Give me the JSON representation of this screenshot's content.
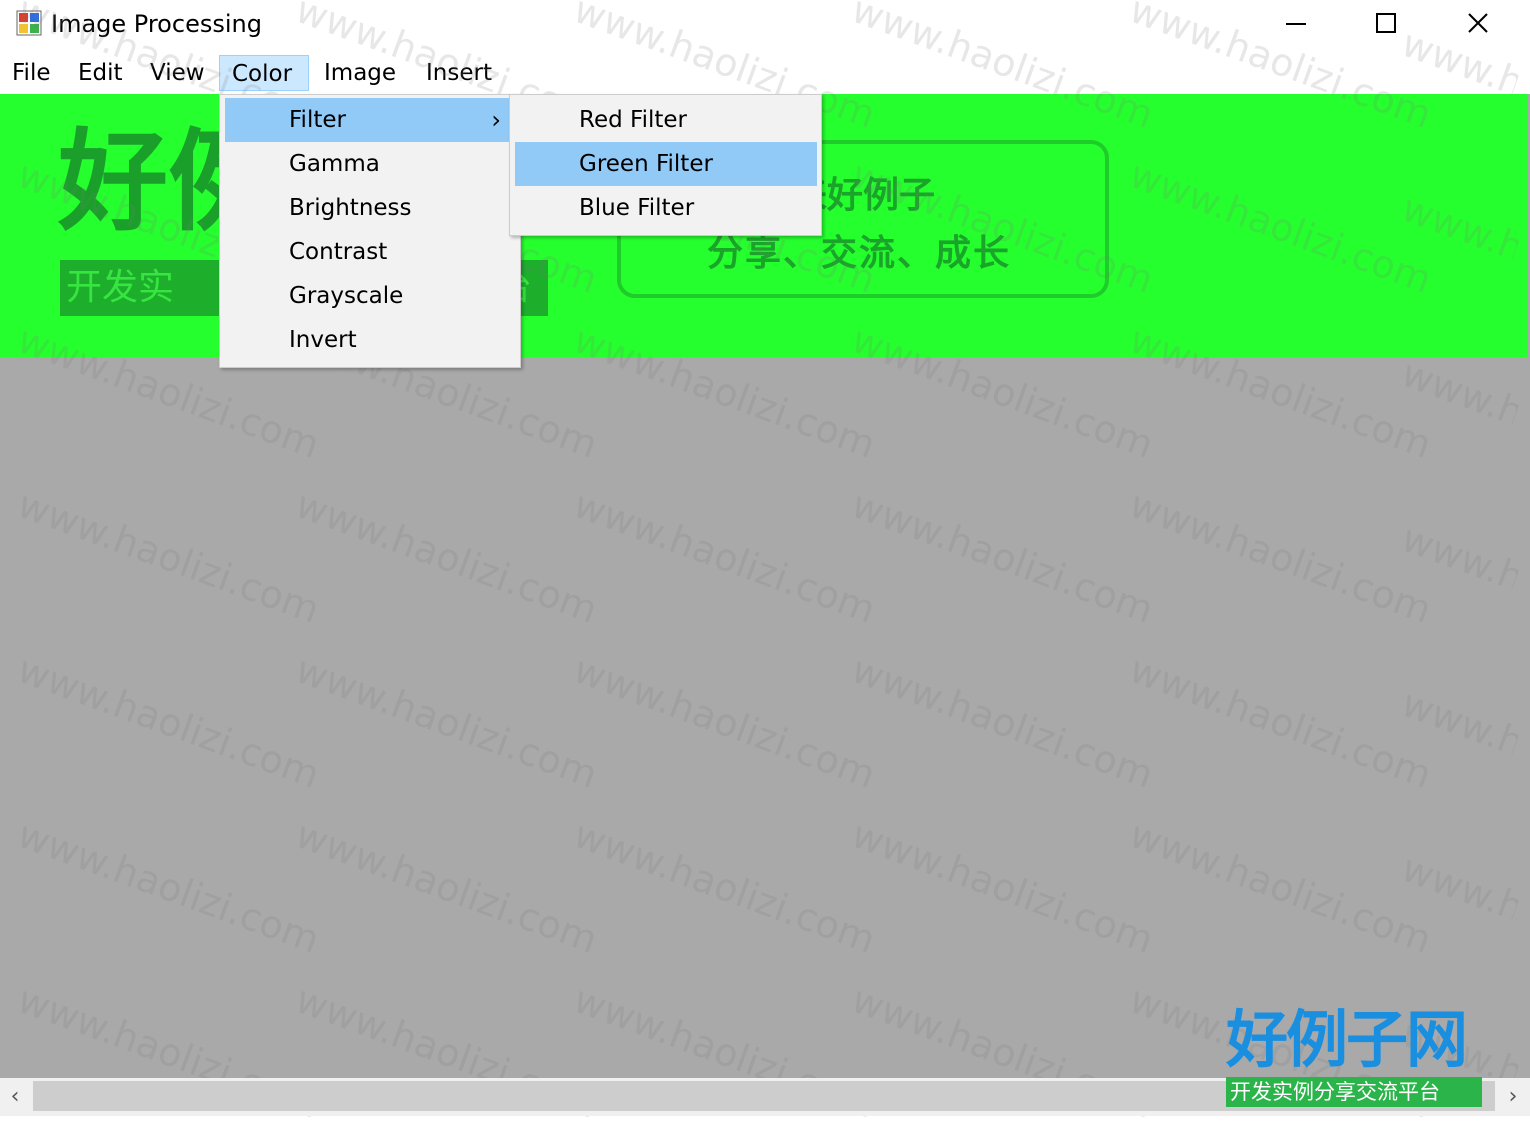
{
  "window": {
    "title": "Image Processing",
    "icon": "app-icon"
  },
  "menubar": {
    "items": [
      "File",
      "Edit",
      "View",
      "Color",
      "Image",
      "Insert"
    ],
    "active": "Color"
  },
  "color_menu": {
    "items": [
      "Filter",
      "Gamma",
      "Brightness",
      "Contrast",
      "Grayscale",
      "Invert"
    ],
    "highlighted": "Filter"
  },
  "filter_submenu": {
    "items": [
      "Red Filter",
      "Green Filter",
      "Blue Filter"
    ],
    "highlighted": "Green Filter"
  },
  "image": {
    "logo_text": "好例",
    "logo_sub": "开发实",
    "logo_sub_tail": "台",
    "slogan_line1": "来好例子",
    "slogan_line2": "分享、交流、成长",
    "tint_color": "#26ff2e"
  },
  "brand": {
    "title": "好例子网",
    "subtitle": "开发实例分享交流平台"
  },
  "watermark_text": "www.haolizi.com",
  "colors": {
    "canvas_background": "#a9a9a9",
    "menu_highlight": "#91c9f7",
    "menubar_active": "#cce8ff"
  }
}
